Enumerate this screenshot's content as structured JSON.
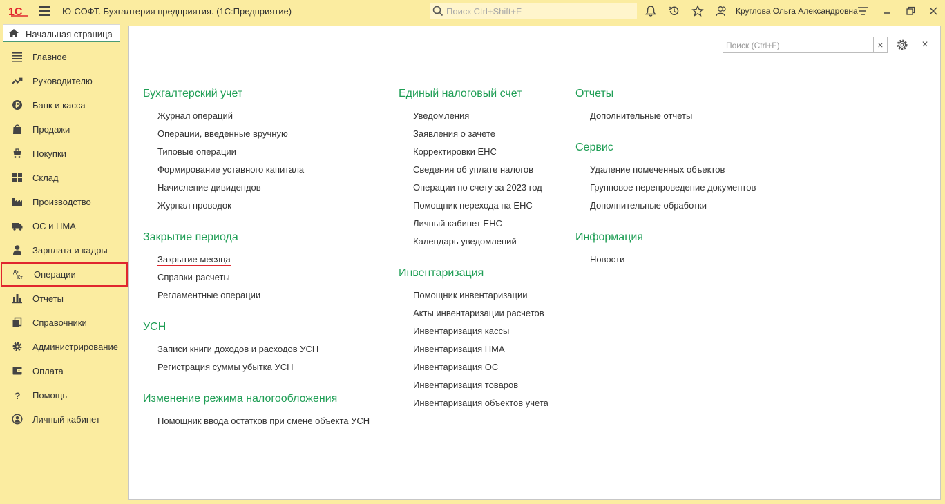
{
  "app": {
    "title": "Ю-СОФТ. Бухгалтерия предприятия.  (1С:Предприятие)",
    "search_placeholder": "Поиск Ctrl+Shift+F",
    "user_name": "Круглова Ольга Александровна",
    "colors": {
      "panel_bg": "#fbeca0",
      "section_green": "#1f9e55",
      "highlight_red": "#e0262e",
      "logo_red": "#e0262e"
    }
  },
  "tabs": {
    "home_label": "Начальная страница"
  },
  "sidebar": {
    "items": [
      {
        "label": "Главное",
        "icon": "menu-lines-icon"
      },
      {
        "label": "Руководителю",
        "icon": "trend-up-icon"
      },
      {
        "label": "Банк и касса",
        "icon": "ruble-coin-icon"
      },
      {
        "label": "Продажи",
        "icon": "shopping-bag-icon"
      },
      {
        "label": "Покупки",
        "icon": "shopping-cart-icon"
      },
      {
        "label": "Склад",
        "icon": "warehouse-grid-icon"
      },
      {
        "label": "Производство",
        "icon": "factory-icon"
      },
      {
        "label": "ОС и НМА",
        "icon": "truck-icon"
      },
      {
        "label": "Зарплата и кадры",
        "icon": "person-icon"
      },
      {
        "label": "Операции",
        "icon": "dt-kt-icon",
        "selected": true
      },
      {
        "label": "Отчеты",
        "icon": "bar-chart-icon"
      },
      {
        "label": "Справочники",
        "icon": "books-icon"
      },
      {
        "label": "Администрирование",
        "icon": "gear-icon"
      },
      {
        "label": "Оплата",
        "icon": "wallet-icon"
      },
      {
        "label": "Помощь",
        "icon": "question-icon"
      },
      {
        "label": "Личный кабинет",
        "icon": "account-circle-icon"
      }
    ]
  },
  "panel": {
    "search_placeholder": "Поиск (Ctrl+F)",
    "clear_label": "×",
    "close_label": "×"
  },
  "sections": {
    "accounting": {
      "title": "Бухгалтерский учет",
      "links": [
        "Журнал операций",
        "Операции, введенные вручную",
        "Типовые операции",
        "Формирование уставного капитала",
        "Начисление дивидендов",
        "Журнал проводок"
      ]
    },
    "period_close": {
      "title": "Закрытие периода",
      "links": [
        "Закрытие месяца",
        "Справки-расчеты",
        "Регламентные операции"
      ]
    },
    "usn": {
      "title": "УСН",
      "links": [
        "Записи книги доходов и расходов УСН",
        "Регистрация суммы убытка УСН"
      ]
    },
    "tax_mode": {
      "title": "Изменение режима налогообложения",
      "links": [
        "Помощник ввода остатков при смене объекта УСН"
      ]
    },
    "ens": {
      "title": "Единый налоговый счет",
      "links": [
        "Уведомления",
        "Заявления о зачете",
        "Корректировки ЕНС",
        "Сведения об уплате налогов",
        "Операции по счету за 2023 год",
        "Помощник перехода на ЕНС",
        "Личный кабинет ЕНС",
        "Календарь уведомлений"
      ]
    },
    "inventory": {
      "title": "Инвентаризация",
      "links": [
        "Помощник инвентаризации",
        "Акты инвентаризации расчетов",
        "Инвентаризация кассы",
        "Инвентаризация НМА",
        "Инвентаризация ОС",
        "Инвентаризация товаров",
        "Инвентаризация объектов учета"
      ]
    },
    "reports": {
      "title": "Отчеты",
      "links": [
        "Дополнительные отчеты"
      ]
    },
    "service": {
      "title": "Сервис",
      "links": [
        "Удаление помеченных объектов",
        "Групповое перепроведение документов",
        "Дополнительные обработки"
      ]
    },
    "info": {
      "title": "Информация",
      "links": [
        "Новости"
      ]
    }
  }
}
